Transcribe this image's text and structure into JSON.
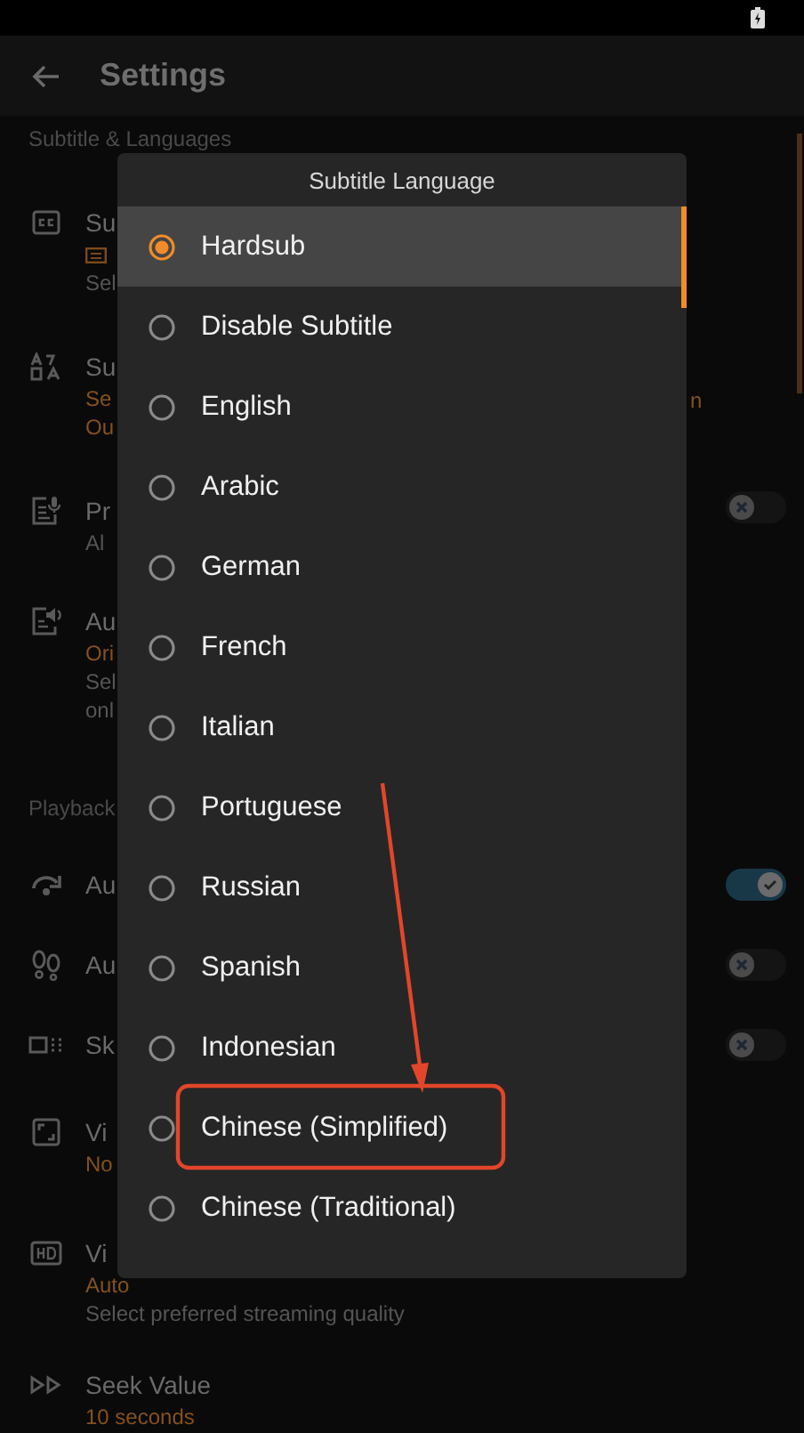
{
  "app_bar": {
    "title": "Settings"
  },
  "sections": [
    {
      "header": "Subtitle & Languages",
      "rows": [
        {
          "title": "Su",
          "lines": [
            {
              "kind": "icon"
            },
            {
              "text": "Sel",
              "kind": "muted"
            }
          ]
        },
        {
          "title": "Su",
          "trailing": "n",
          "lines": [
            {
              "text": "Se",
              "kind": "accent"
            },
            {
              "text": "Ou",
              "kind": "accent"
            }
          ]
        },
        {
          "title": "Pr",
          "toggle": {
            "on": false
          },
          "lines": [
            {
              "text": "Al",
              "kind": "muted"
            }
          ]
        },
        {
          "title": "Au",
          "lines": [
            {
              "text": "Ori",
              "kind": "accent"
            },
            {
              "text": "Sel",
              "kind": "muted"
            },
            {
              "text": "onl",
              "kind": "muted"
            }
          ]
        }
      ]
    },
    {
      "header": "Playback",
      "rows": [
        {
          "title": "Au",
          "toggle": {
            "on": true
          },
          "lines": []
        },
        {
          "title": "Au",
          "toggle": {
            "on": false
          },
          "lines": []
        },
        {
          "title": "Sk",
          "toggle": {
            "on": false
          },
          "lines": []
        },
        {
          "title": "Vi",
          "lines": [
            {
              "text": "No",
              "kind": "accent"
            }
          ]
        },
        {
          "title": "Vi",
          "lines": [
            {
              "text": "Auto",
              "kind": "accent"
            },
            {
              "text": "Select preferred streaming quality",
              "kind": "muted"
            }
          ]
        },
        {
          "title": "Seek Value",
          "lines": [
            {
              "text": "10 seconds",
              "kind": "accent"
            }
          ]
        }
      ]
    }
  ],
  "dialog": {
    "title": "Subtitle Language",
    "options": [
      {
        "label": "Hardsub",
        "selected": true
      },
      {
        "label": "Disable Subtitle",
        "selected": false
      },
      {
        "label": "English",
        "selected": false
      },
      {
        "label": "Arabic",
        "selected": false
      },
      {
        "label": "German",
        "selected": false
      },
      {
        "label": "French",
        "selected": false
      },
      {
        "label": "Italian",
        "selected": false
      },
      {
        "label": "Portuguese",
        "selected": false
      },
      {
        "label": "Russian",
        "selected": false
      },
      {
        "label": "Spanish",
        "selected": false
      },
      {
        "label": "Indonesian",
        "selected": false
      },
      {
        "label": "Chinese (Simplified)",
        "selected": false
      },
      {
        "label": "Chinese (Traditional)",
        "selected": false
      }
    ]
  }
}
